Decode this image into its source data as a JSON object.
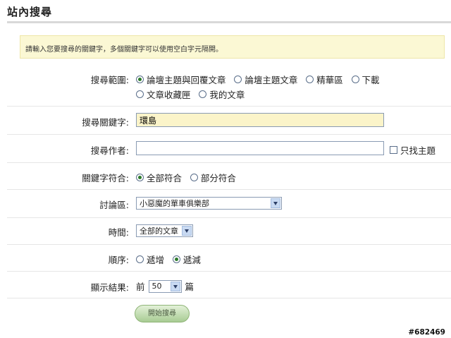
{
  "page_title": "站內搜尋",
  "notice": "請輸入您要搜尋的關鍵字，多個關鍵字可以使用空白字元隔開。",
  "scope": {
    "label": "搜尋範圍:",
    "options": [
      "論壇主題與回覆文章",
      "論壇主題文章",
      "精華區",
      "下載",
      "文章收藏匣",
      "我的文章"
    ],
    "selected": "論壇主題與回覆文章"
  },
  "keyword": {
    "label": "搜尋關鍵字:",
    "value": "環島"
  },
  "author": {
    "label": "搜尋作者:",
    "value": "",
    "topic_only_label": "只找主題",
    "topic_only_checked": false
  },
  "match": {
    "label": "關鍵字符合:",
    "options": [
      "全部符合",
      "部分符合"
    ],
    "selected": "全部符合"
  },
  "forum": {
    "label": "討論區:",
    "value": "小惡魔的單車俱樂部"
  },
  "time": {
    "label": "時間:",
    "value": "全部的文章"
  },
  "order": {
    "label": "順序:",
    "options": [
      "遞增",
      "遞減"
    ],
    "selected": "遞減"
  },
  "results": {
    "label": "顯示結果:",
    "prefix": "前",
    "value": "50",
    "suffix": "篇"
  },
  "submit_label": "開始搜尋",
  "watermark": "#682469",
  "colors": {
    "notice_bg": "#fbf8d4",
    "keyword_field_bg": "#fbf4c9",
    "button_green": "#a8cc93"
  }
}
